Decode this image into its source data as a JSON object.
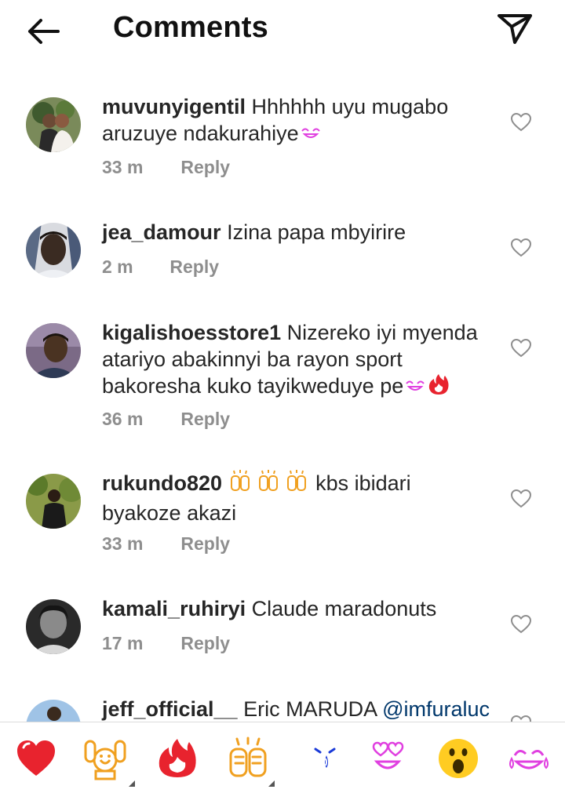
{
  "header": {
    "title": "Comments"
  },
  "comments": [
    {
      "username": "muvunyigentil",
      "text": "Hhhhhh uyu mugabo aruzuye ndakurahiye",
      "time": "33 m",
      "reply": "Reply"
    },
    {
      "username": "jea_damour",
      "text": "Izina papa mbyirire",
      "time": "2 m",
      "reply": "Reply"
    },
    {
      "username": "kigalishoesstore1",
      "text": "Nizereko iyi myenda atariyo abakinnyi ba rayon sport bakoresha kuko tayikweduye pe",
      "time": "36 m",
      "reply": "Reply"
    },
    {
      "username": "rukundo820",
      "text": "kbs ibidari byakoze akazi",
      "time": "33 m",
      "reply": "Reply"
    },
    {
      "username": "kamali_ruhiryi",
      "text": "Claude maradonuts",
      "time": "17 m",
      "reply": "Reply"
    },
    {
      "username": "jeff_official__",
      "text": "Eric MARUDA",
      "mention": "@imfuraluc"
    }
  ],
  "emoji_bar": [
    "red-heart",
    "raising-hands",
    "fire",
    "clapping-hands",
    "crying-face",
    "heart-eyes",
    "astonished-face",
    "face-with-tears-of-joy"
  ],
  "colors": {
    "text": "#262626",
    "meta": "#8e8e8e",
    "mention": "#00376b",
    "like": "#ed4956",
    "divider": "#dbdbdb"
  }
}
